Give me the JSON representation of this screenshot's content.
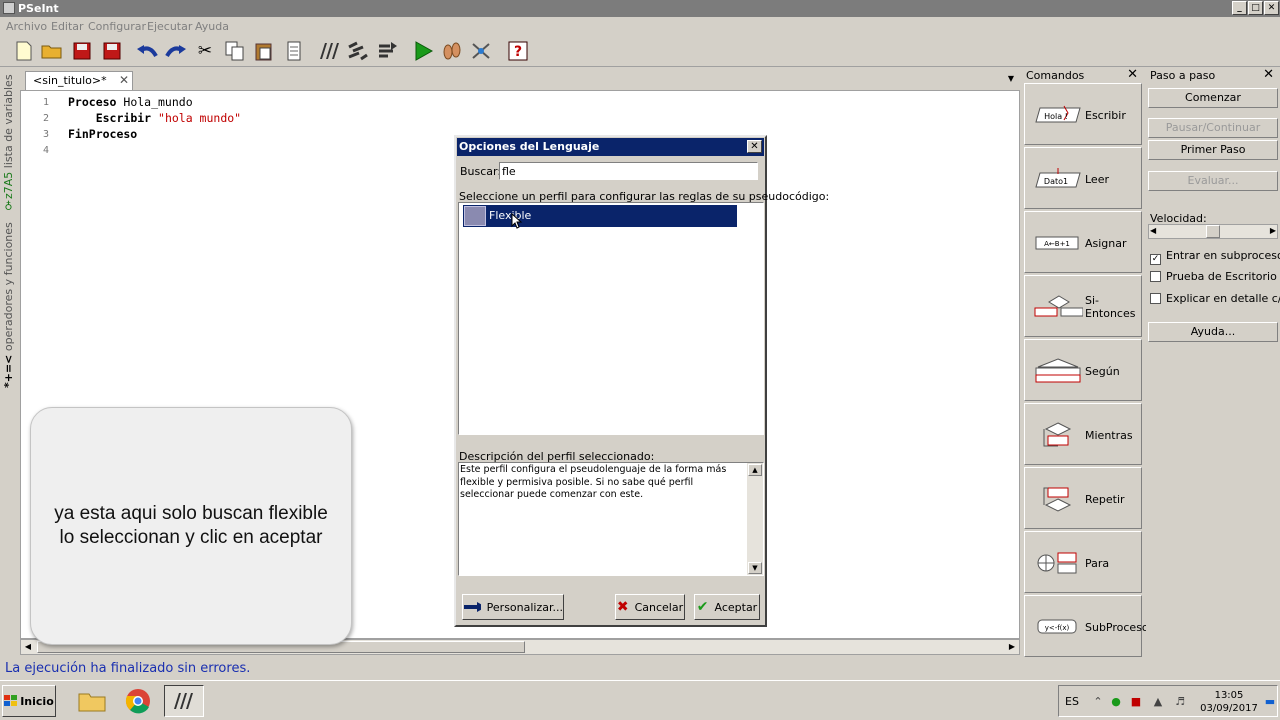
{
  "window": {
    "title": "PSeInt"
  },
  "menu": [
    "Archivo",
    "Editar",
    "Configurar",
    "Ejecutar",
    "Ayuda"
  ],
  "side_tabs": {
    "variables": "lista de variables",
    "operators": "operadores y funciones",
    "variables_glyph": "♀z7A5",
    "operators_glyph": "*+=<"
  },
  "editor": {
    "tab_label": "<sin_titulo>*",
    "lines": [
      {
        "num": "1",
        "kw1": "Proceso",
        "rest": " Hola_mundo",
        "kw2": "",
        "str": ""
      },
      {
        "num": "2",
        "kw1": "",
        "rest": "    ",
        "kw2": "Escribir",
        "str": " \"hola mundo\""
      },
      {
        "num": "3",
        "kw1": "FinProceso",
        "rest": "",
        "kw2": "",
        "str": ""
      },
      {
        "num": "4",
        "kw1": "",
        "rest": "",
        "kw2": "",
        "str": ""
      }
    ]
  },
  "status": "La ejecución ha finalizado sin errores.",
  "commands": {
    "title": "Comandos",
    "items": [
      {
        "label": "Escribir",
        "icon": "write-icon",
        "icon_text": "Hola !"
      },
      {
        "label": "Leer",
        "icon": "read-icon",
        "icon_text": "Dato1"
      },
      {
        "label": "Asignar",
        "icon": "assign-icon",
        "icon_text": "A←B+1"
      },
      {
        "label": "Si-Entonces",
        "icon": "if-then-icon",
        "icon_text": ""
      },
      {
        "label": "Según",
        "icon": "switch-icon",
        "icon_text": ""
      },
      {
        "label": "Mientras",
        "icon": "while-icon",
        "icon_text": ""
      },
      {
        "label": "Repetir",
        "icon": "repeat-icon",
        "icon_text": ""
      },
      {
        "label": "Para",
        "icon": "for-icon",
        "icon_text": ""
      },
      {
        "label": "SubProceso",
        "icon": "subprocess-icon",
        "icon_text": "y<-f(x)"
      }
    ]
  },
  "stepper": {
    "title": "Paso a paso",
    "start": "Comenzar",
    "pause": "Pausar/Continuar",
    "first_step": "Primer Paso",
    "evaluate": "Evaluar...",
    "speed_label": "Velocidad:",
    "speed_value": 0.5,
    "checks": [
      {
        "label": "Entrar en subprocesos",
        "checked": true
      },
      {
        "label": "Prueba de Escritorio",
        "checked": false
      },
      {
        "label": "Explicar en detalle c/paso",
        "checked": false
      }
    ],
    "help": "Ayuda..."
  },
  "bubble": {
    "text": "ya esta aqui solo buscan flexible lo seleccionan y clic en aceptar"
  },
  "dialog": {
    "title": "Opciones del Lenguaje",
    "search_label": "Buscar:",
    "search_value": "fle",
    "list_label": "Seleccione un perfil para configurar las reglas de su pseudocódigo:",
    "selected_profile": "Flexible",
    "desc_label": "Descripción del perfil seleccionado:",
    "desc_text": "Este perfil configura el pseudolenguaje de la forma más flexible y permisiva posible. Si no sabe qué perfil seleccionar puede comenzar con este.",
    "customize": "Personalizar...",
    "cancel": "Cancelar",
    "accept": "Aceptar"
  },
  "taskbar": {
    "start": "Inicio",
    "lang": "ES",
    "time": "13:05",
    "date": "03/09/2017"
  },
  "colors": {
    "dialog_title_bg": "#0a246a",
    "status_text": "#1a2fb0",
    "string_literal": "#c00000",
    "run_green": "#1a9a1a"
  }
}
